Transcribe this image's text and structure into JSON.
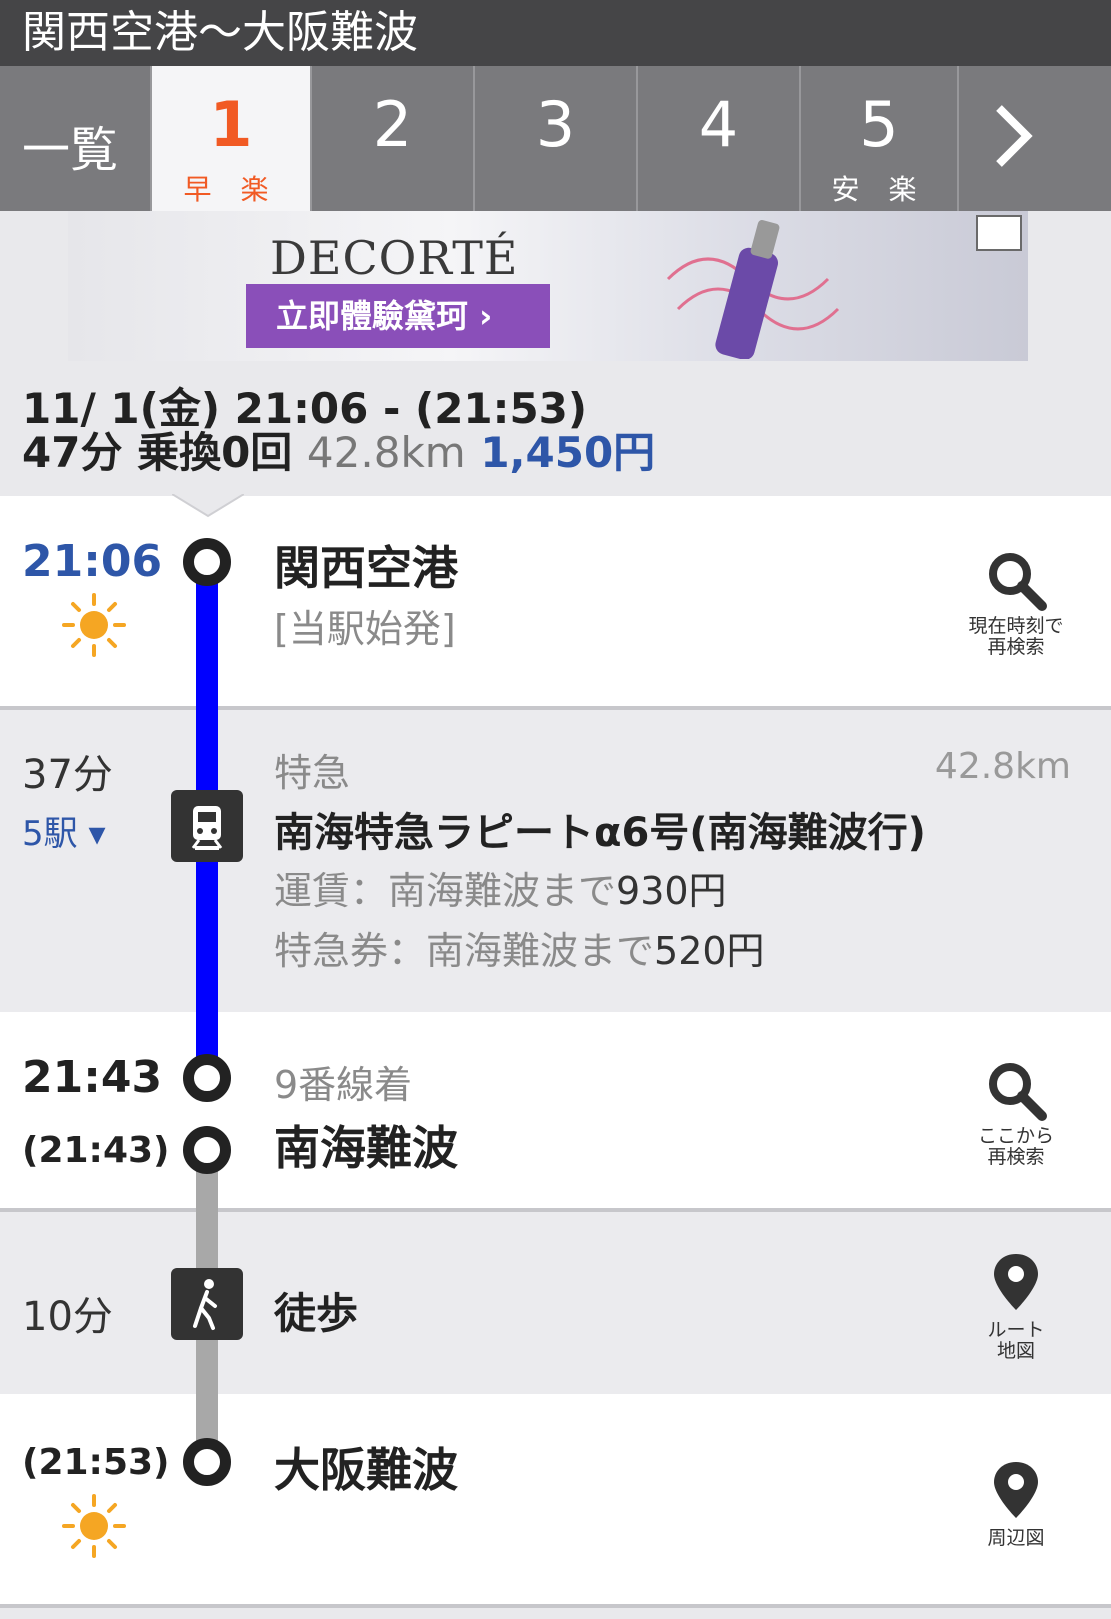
{
  "header": {
    "title": "関西空港〜大阪難波"
  },
  "tabs": [
    {
      "num": "一覧",
      "sub": ""
    },
    {
      "num": "1",
      "sub": "早 楽"
    },
    {
      "num": "2",
      "sub": ""
    },
    {
      "num": "3",
      "sub": ""
    },
    {
      "num": "4",
      "sub": ""
    },
    {
      "num": "5",
      "sub": "安 楽"
    }
  ],
  "ad": {
    "brand": "DECORTÉ",
    "cta": "立即體驗黛珂 ›"
  },
  "summary": {
    "datetime": "11/ 1(金) 21:06 - (21:53)",
    "duration_transfers": "47分 乗換0回",
    "distance": "42.8km",
    "fare": "1,450円"
  },
  "departure": {
    "time": "21:06",
    "station": "関西空港",
    "note": "[当駅始発]",
    "action": [
      "現在時刻で",
      "再検索"
    ]
  },
  "ride": {
    "duration": "37分",
    "stops": "5駅 ▾",
    "type": "特急",
    "distance": "42.8km",
    "train": "南海特急ラピートα6号(南海難波行)",
    "fare_label": "運賃：南海難波まで",
    "fare_amount": "930円",
    "express_label": "特急券：南海難波まで",
    "express_amount": "520円"
  },
  "arrival": {
    "time": "21:43",
    "time2": "(21:43)",
    "platform": "9番線着",
    "station": "南海難波",
    "action": [
      "ここから",
      "再検索"
    ]
  },
  "walk": {
    "duration": "10分",
    "label": "徒歩",
    "action": [
      "ルート",
      "地図"
    ]
  },
  "destination": {
    "time": "(21:53)",
    "station": "大阪難波",
    "action": [
      "周辺図"
    ]
  }
}
